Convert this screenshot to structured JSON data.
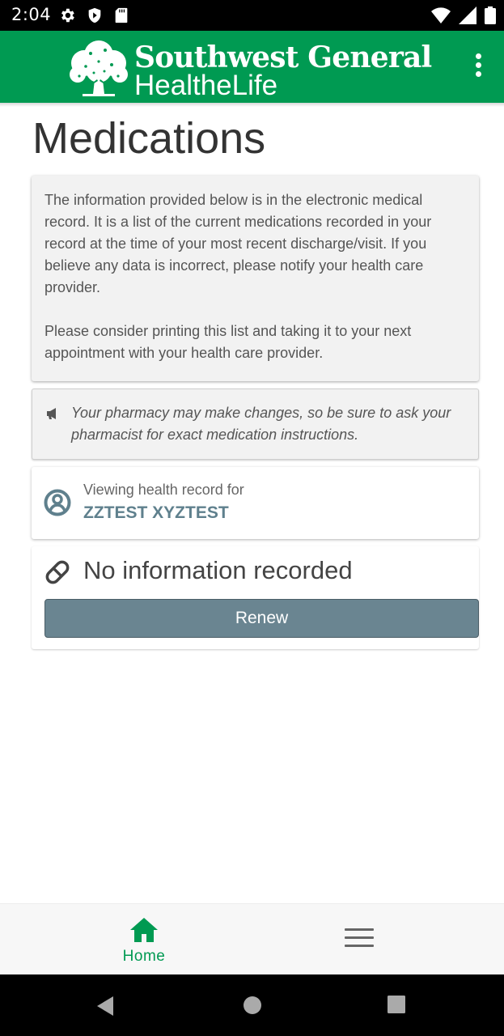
{
  "status_bar": {
    "time": "2:04",
    "left_icons": [
      "gear-icon",
      "shield-icon",
      "sd-card-icon"
    ],
    "right_icons": [
      "wifi-icon",
      "signal-icon",
      "battery-icon"
    ]
  },
  "header": {
    "brand_line1": "Southwest General",
    "brand_line2": "HealtheLife",
    "logo_icon": "tree-logo-icon",
    "menu_icon": "more-vertical-icon",
    "background_color": "#009a52"
  },
  "page": {
    "title": "Medications"
  },
  "info_card": {
    "paragraph1": "The information provided below is in the electronic medical record. It is a list of the current medications recorded in your record at the time of your most recent discharge/visit. If you believe any data is incorrect, please notify your health care provider.",
    "paragraph2": "Please consider printing this list and taking it to your next appointment with your health care provider."
  },
  "pharmacy_note": {
    "icon": "megaphone-icon",
    "text": "Your pharmacy may make changes, so be sure to ask your pharmacist for exact medication instructions."
  },
  "record": {
    "icon": "user-circle-icon",
    "label": "Viewing health record for",
    "patient_name": "ZZTEST XYZTEST",
    "name_color": "#5f808d"
  },
  "medications": {
    "icon": "pill-icon",
    "empty_text": "No information recorded",
    "renew_label": "Renew",
    "button_color": "#6a8591"
  },
  "bottom_nav": {
    "home_label": "Home",
    "home_icon": "home-icon",
    "menu_icon": "hamburger-menu-icon",
    "active_color": "#009a52"
  },
  "system_nav": {
    "icons": [
      "back-icon",
      "home-circle-icon",
      "recents-icon"
    ]
  }
}
